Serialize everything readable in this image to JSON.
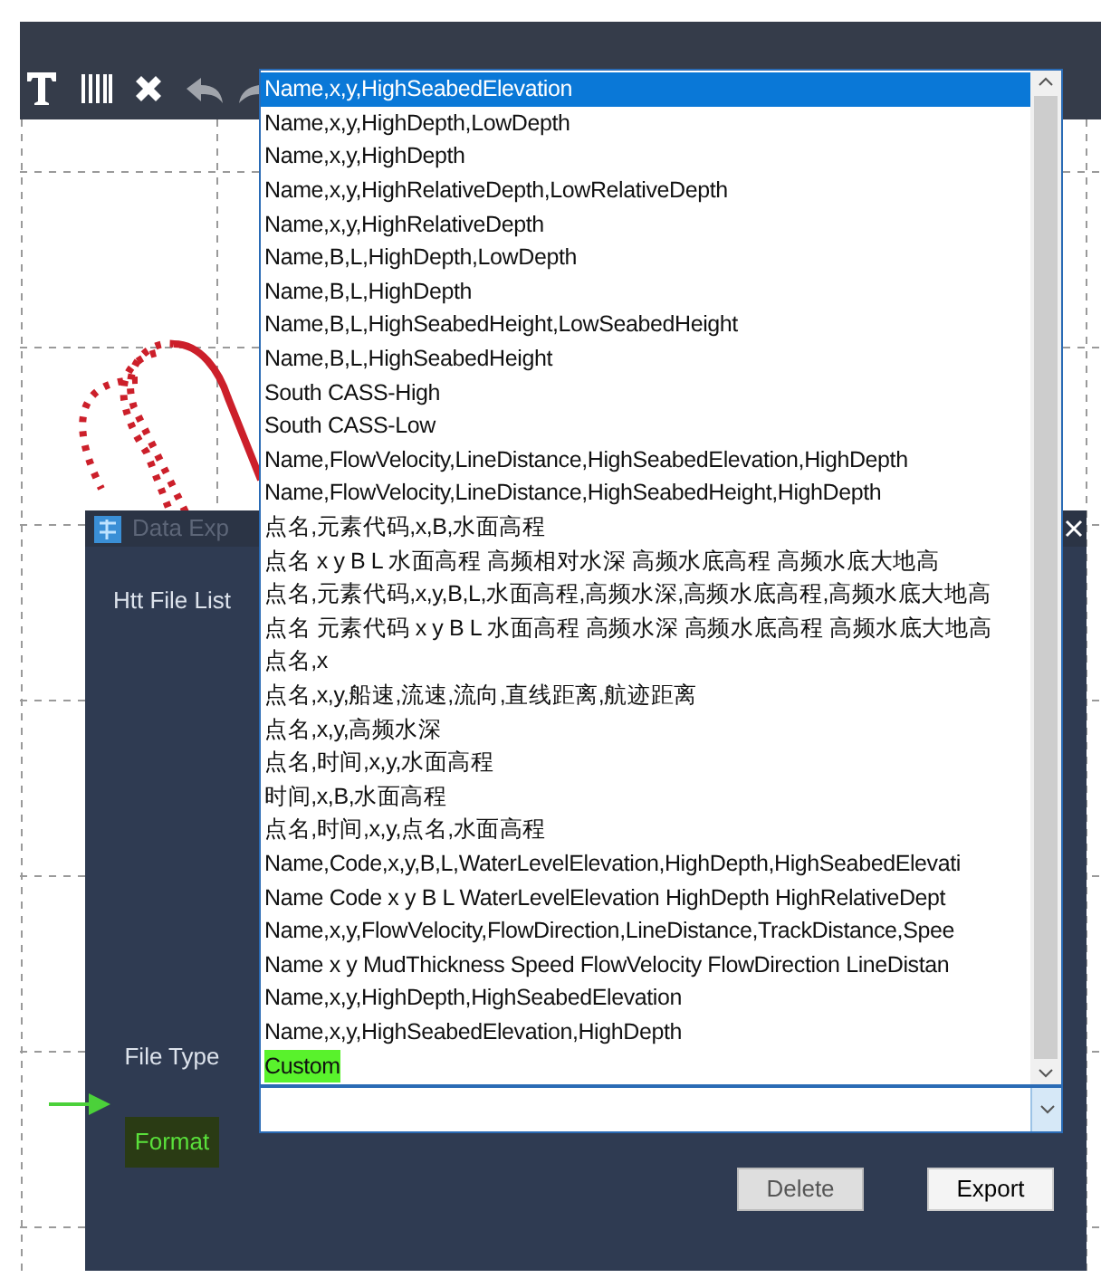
{
  "dialog": {
    "title": "Data Exp",
    "labels": [
      {
        "text": "Htt File List",
        "highlighted": false
      },
      {
        "text": "File Type",
        "highlighted": false
      },
      {
        "text": "Format",
        "highlighted": true
      }
    ],
    "buttons": [
      {
        "label": "Delete",
        "disabled": true
      },
      {
        "label": "Export",
        "disabled": false
      }
    ]
  },
  "dropdown": {
    "items": [
      {
        "text": "Name,x,y,HighSeabedElevation",
        "selected": true,
        "marked": false
      },
      {
        "text": "Name,x,y,HighDepth,LowDepth",
        "selected": false,
        "marked": false
      },
      {
        "text": "Name,x,y,HighDepth",
        "selected": false,
        "marked": false
      },
      {
        "text": "Name,x,y,HighRelativeDepth,LowRelativeDepth",
        "selected": false,
        "marked": false
      },
      {
        "text": "Name,x,y,HighRelativeDepth",
        "selected": false,
        "marked": false
      },
      {
        "text": "Name,B,L,HighDepth,LowDepth",
        "selected": false,
        "marked": false
      },
      {
        "text": "Name,B,L,HighDepth",
        "selected": false,
        "marked": false
      },
      {
        "text": "Name,B,L,HighSeabedHeight,LowSeabedHeight",
        "selected": false,
        "marked": false
      },
      {
        "text": "Name,B,L,HighSeabedHeight",
        "selected": false,
        "marked": false
      },
      {
        "text": "South CASS-High",
        "selected": false,
        "marked": false
      },
      {
        "text": "South CASS-Low",
        "selected": false,
        "marked": false
      },
      {
        "text": "Name,FlowVelocity,LineDistance,HighSeabedElevation,HighDepth",
        "selected": false,
        "marked": false
      },
      {
        "text": "Name,FlowVelocity,LineDistance,HighSeabedHeight,HighDepth",
        "selected": false,
        "marked": false
      },
      {
        "text": "点名,元素代码,x,B,水面高程",
        "selected": false,
        "marked": false
      },
      {
        "text": "点名 x y B L 水面高程 高频相对水深 高频水底高程 高频水底大地高",
        "selected": false,
        "marked": false
      },
      {
        "text": "点名,元素代码,x,y,B,L,水面高程,高频水深,高频水底高程,高频水底大地高",
        "selected": false,
        "marked": false
      },
      {
        "text": "点名 元素代码 x y B L 水面高程 高频水深 高频水底高程 高频水底大地高",
        "selected": false,
        "marked": false
      },
      {
        "text": "点名,x",
        "selected": false,
        "marked": false
      },
      {
        "text": "点名,x,y,船速,流速,流向,直线距离,航迹距离",
        "selected": false,
        "marked": false
      },
      {
        "text": "点名,x,y,高频水深",
        "selected": false,
        "marked": false
      },
      {
        "text": "点名,时间,x,y,水面高程",
        "selected": false,
        "marked": false
      },
      {
        "text": "时间,x,B,水面高程",
        "selected": false,
        "marked": false
      },
      {
        "text": "点名,时间,x,y,点名,水面高程",
        "selected": false,
        "marked": false
      },
      {
        "text": "Name,Code,x,y,B,L,WaterLevelElevation,HighDepth,HighSeabedElevati",
        "selected": false,
        "marked": false
      },
      {
        "text": "Name Code x y B L WaterLevelElevation HighDepth HighRelativeDept",
        "selected": false,
        "marked": false
      },
      {
        "text": "Name,x,y,FlowVelocity,FlowDirection,LineDistance,TrackDistance,Spee",
        "selected": false,
        "marked": false
      },
      {
        "text": "Name x y MudThickness Speed FlowVelocity FlowDirection LineDistan",
        "selected": false,
        "marked": false
      },
      {
        "text": "Name,x,y,HighDepth,HighSeabedElevation",
        "selected": false,
        "marked": false
      },
      {
        "text": "Name,x,y,HighSeabedElevation,HighDepth",
        "selected": false,
        "marked": false
      },
      {
        "text": "Custom",
        "selected": false,
        "marked": true
      }
    ]
  }
}
